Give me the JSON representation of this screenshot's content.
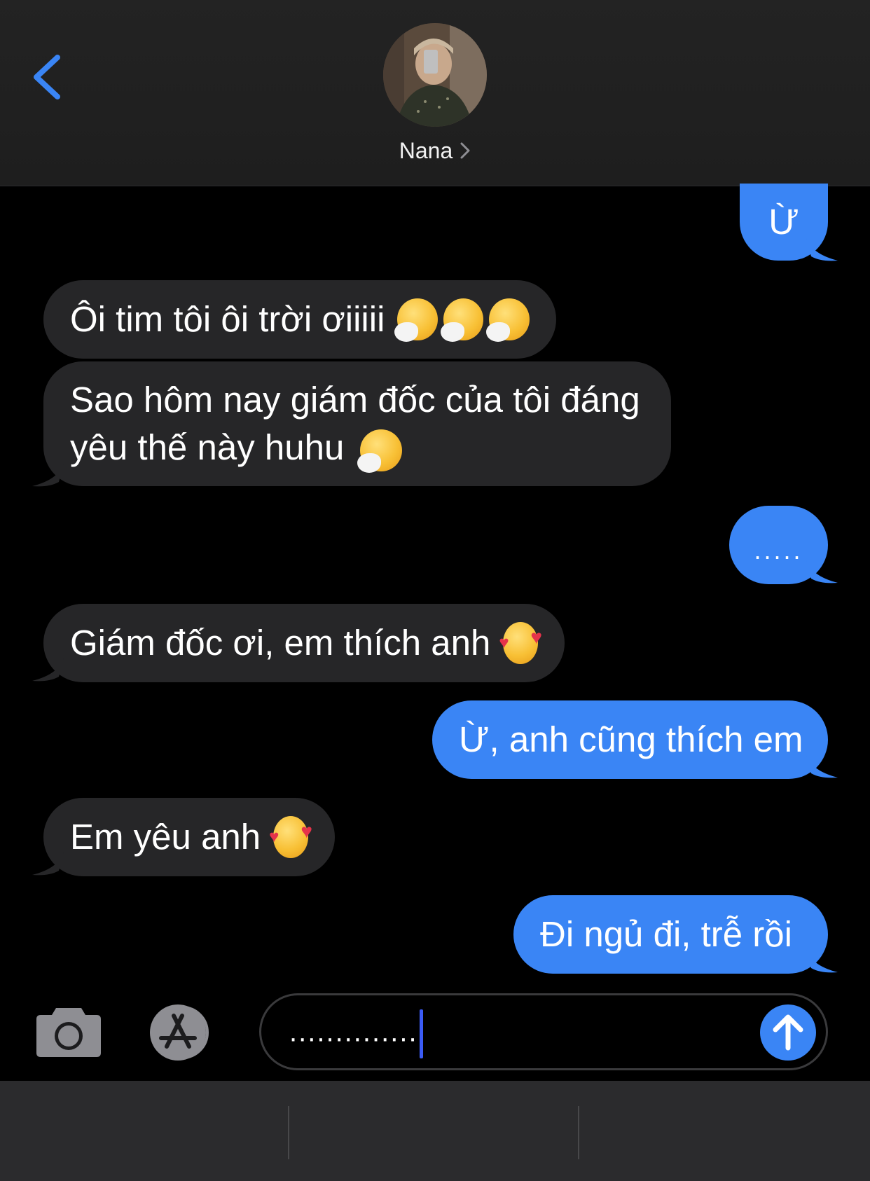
{
  "header": {
    "contact_name": "Nana"
  },
  "messages": [
    {
      "direction": "out",
      "text": "Ừ"
    },
    {
      "direction": "in",
      "text": "Ôi tim tôi ôi trời ơiiiii"
    },
    {
      "direction": "in",
      "text": "Sao hôm nay giám đốc của tôi đáng yêu thế này huhu"
    },
    {
      "direction": "out",
      "text": "....."
    },
    {
      "direction": "in",
      "text": "Giám đốc ơi, em thích anh"
    },
    {
      "direction": "out",
      "text": "Ừ, anh cũng thích em"
    },
    {
      "direction": "in",
      "text": "Em yêu anh"
    },
    {
      "direction": "out",
      "text": "Đi ngủ đi, trễ rồi"
    }
  ],
  "input": {
    "value": ".............."
  },
  "icons": {
    "back": "chevron-left-icon",
    "camera": "camera-icon",
    "appstore": "app-store-icon",
    "send": "arrow-up-icon",
    "emoji_sneeze": "sneezing-face-emoji",
    "emoji_love": "smiling-face-with-hearts-emoji"
  },
  "colors": {
    "accent": "#3a85f5",
    "incoming_bubble": "#262628",
    "header_bg": "#222222",
    "background": "#000000"
  }
}
